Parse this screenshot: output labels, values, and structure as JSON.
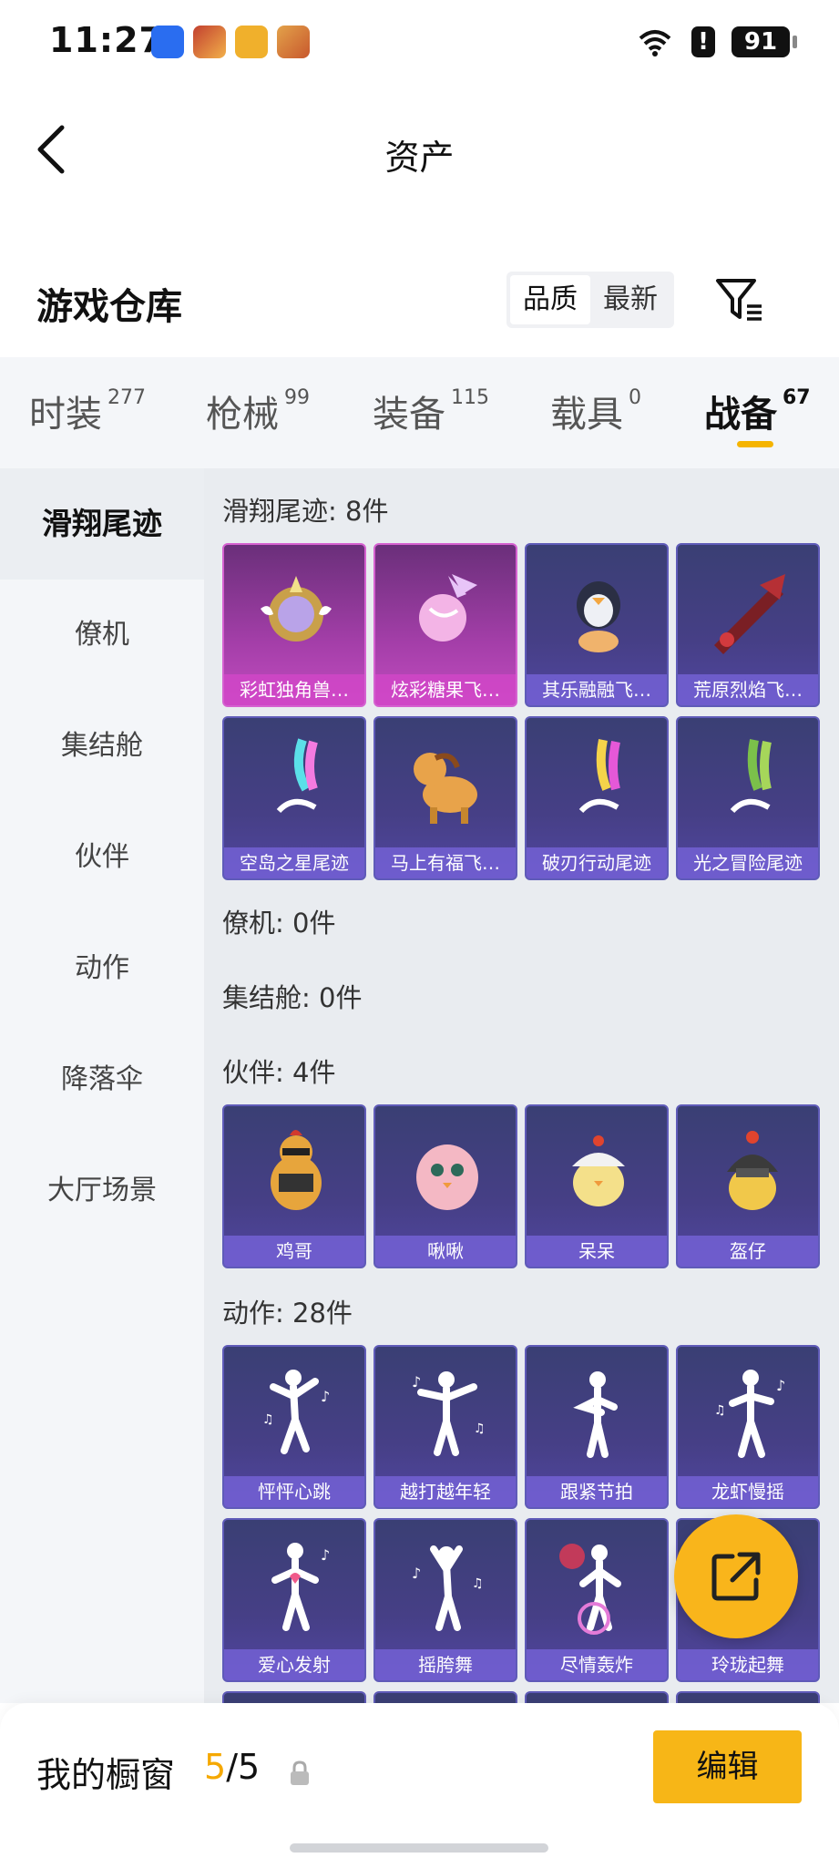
{
  "status_bar": {
    "time": "11:27",
    "battery": "91",
    "alert": "!"
  },
  "header": {
    "title": "资产"
  },
  "section": {
    "title": "游戏仓库",
    "sort_options": [
      "品质",
      "最新"
    ]
  },
  "tabs": [
    {
      "label": "时装",
      "count": "277"
    },
    {
      "label": "枪械",
      "count": "99"
    },
    {
      "label": "装备",
      "count": "115"
    },
    {
      "label": "载具",
      "count": "0"
    },
    {
      "label": "战备",
      "count": "67"
    }
  ],
  "sidebar": [
    "滑翔尾迹",
    "僚机",
    "集结舱",
    "伙伴",
    "动作",
    "降落伞",
    "大厅场景"
  ],
  "groups": {
    "glide": {
      "label": "滑翔尾迹: 8件",
      "items": [
        "彩虹独角兽…",
        "炫彩糖果飞…",
        "其乐融融飞…",
        "荒原烈焰飞…",
        "空岛之星尾迹",
        "马上有福飞…",
        "破刃行动尾迹",
        "光之冒险尾迹"
      ]
    },
    "wingman": {
      "label": "僚机: 0件"
    },
    "pod": {
      "label": "集结舱: 0件"
    },
    "partner": {
      "label": "伙伴: 4件",
      "items": [
        "鸡哥",
        "啾啾",
        "呆呆",
        "盔仔"
      ]
    },
    "emote": {
      "label": "动作: 28件",
      "items": [
        "怦怦心跳",
        "越打越年轻",
        "跟紧节拍",
        "龙虾慢摇",
        "爱心发射",
        "摇胯舞",
        "尽情轰炸",
        "玲珑起舞"
      ]
    }
  },
  "bottom": {
    "showcase_label": "我的橱窗",
    "showcase_current": "5",
    "showcase_total": "/5",
    "edit_label": "编辑"
  },
  "colors": {
    "accent": "#f5b400",
    "card": "#463f86",
    "card_rare": "#a33ea8"
  }
}
